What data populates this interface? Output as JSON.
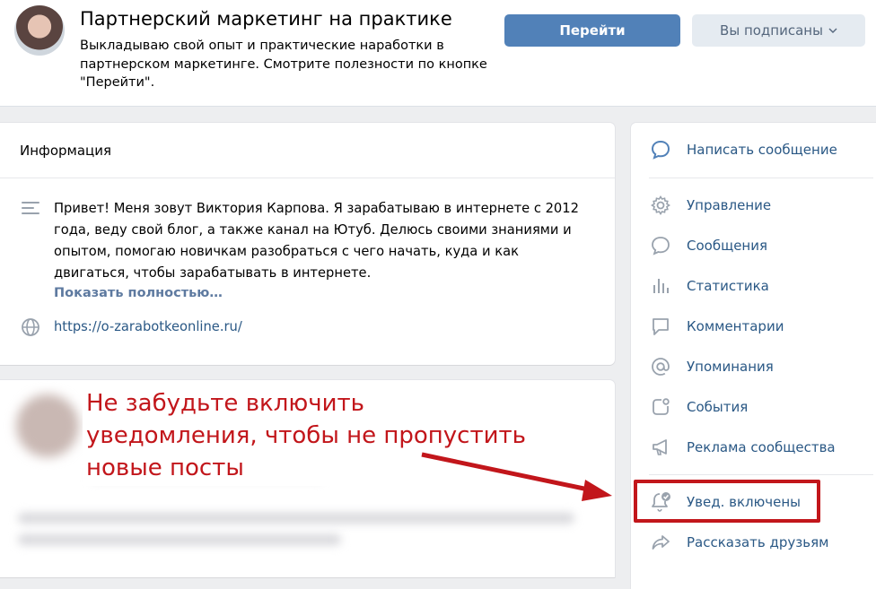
{
  "header": {
    "title": "Партнерский маркетинг на практике",
    "status": "Выкладываю свой опыт и практические наработки в партнерском маркетинге. Смотрите полезности по кнопке \"Перейти\".",
    "go_button": "Перейти",
    "subscribed_button": "Вы подписаны"
  },
  "info": {
    "title": "Информация",
    "about": "Привет! Меня зовут Виктория Карпова. Я зарабатываю в интернете с 2012 года, веду свой блог, а также канал на Ютуб. Делюсь своими знаниями и опытом, помогаю новичкам разобраться с чего начать, куда и как двигаться, чтобы зарабатывать в интернете.",
    "show_more": "Показать полностью…",
    "website": "https://o-zarabotkeonline.ru/"
  },
  "annotation": {
    "text": "Не забудьте включить уведомления, чтобы не пропустить новые посты",
    "color": "#c2161b"
  },
  "menu": {
    "write_message": "Написать сообщение",
    "items": [
      {
        "label": "Управление",
        "icon": "gear-icon"
      },
      {
        "label": "Сообщения",
        "icon": "chat-bubble-icon"
      },
      {
        "label": "Статистика",
        "icon": "bar-chart-icon"
      },
      {
        "label": "Комментарии",
        "icon": "comment-icon"
      },
      {
        "label": "Упоминания",
        "icon": "at-icon"
      },
      {
        "label": "События",
        "icon": "event-icon"
      },
      {
        "label": "Реклама сообщества",
        "icon": "megaphone-icon"
      }
    ],
    "notifications": "Увед. включены",
    "share": "Рассказать друзьям"
  },
  "colors": {
    "accent": "#5181b8",
    "link": "#2a5885",
    "background": "#edeef0",
    "icon": "#99a2ad"
  }
}
